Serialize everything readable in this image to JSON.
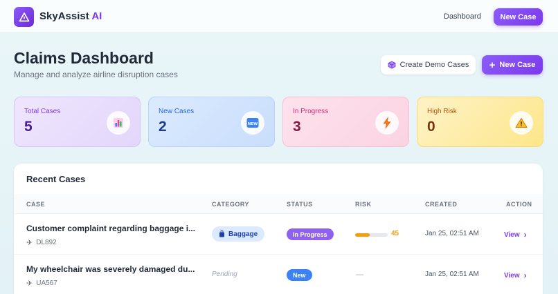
{
  "topbar": {
    "brand_name": "SkyAssist",
    "brand_suffix": "AI",
    "nav_dashboard": "Dashboard",
    "new_case_label": "New Case"
  },
  "header": {
    "title": "Claims Dashboard",
    "subtitle": "Manage and analyze airline disruption cases",
    "create_demo_label": "Create Demo Cases",
    "new_case_label": "New Case"
  },
  "stats": {
    "total": {
      "label": "Total Cases",
      "value": "5",
      "icon": "bar-chart-icon"
    },
    "new": {
      "label": "New Cases",
      "value": "2",
      "icon": "new-badge-icon"
    },
    "progress": {
      "label": "In Progress",
      "value": "3",
      "icon": "lightning-icon"
    },
    "risk": {
      "label": "High Risk",
      "value": "0",
      "icon": "warning-icon"
    }
  },
  "recent": {
    "title": "Recent Cases",
    "columns": {
      "case": "CASE",
      "category": "CATEGORY",
      "status": "STATUS",
      "risk": "RISK",
      "created": "CREATED",
      "action": "ACTION"
    },
    "rows": [
      {
        "title": "Customer complaint regarding baggage i...",
        "flight": "DL892",
        "category": "Baggage",
        "status": "In Progress",
        "risk": 45,
        "risk_label": "45",
        "created": "Jan 25, 02:51 AM",
        "action": "View"
      },
      {
        "title": "My wheelchair was severely damaged du...",
        "flight": "UA567",
        "category": "Pending",
        "status": "New",
        "risk_label": "—",
        "created": "Jan 25, 02:51 AM",
        "action": "View"
      }
    ]
  },
  "colors": {
    "accent": "#7c3aed",
    "status_in_progress": "#9061f0",
    "status_new": "#3b82f6",
    "risk_medium": "#f59e0b"
  }
}
